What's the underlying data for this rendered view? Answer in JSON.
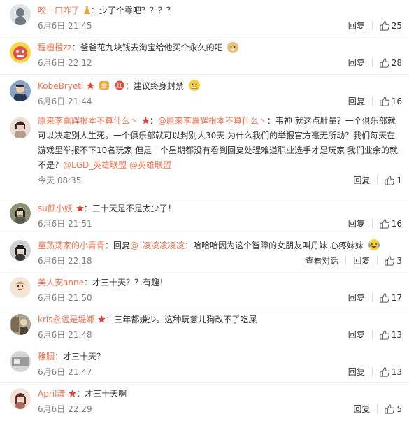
{
  "ui": {
    "reply_label": "回复",
    "view_thread_label": "查看对话"
  },
  "comments": [
    {
      "user": "咬一口咋了",
      "sep": "：",
      "text": "少了个零吧？？？？",
      "time": "6月6日 21:45",
      "likes": "25",
      "avatar_color": "#6d7a84"
    },
    {
      "user": "程檀橙zz",
      "sep": "：",
      "text": "爸爸花九块钱去淘宝给他买个永久的吧",
      "time": "6月6日 22:12",
      "likes": "28",
      "avatar_color": "#e8504a"
    },
    {
      "user": "KobeBryeti",
      "sep": "：",
      "text": "建议终身封禁",
      "time": "6月6日 21:44",
      "likes": "16",
      "avatar_color": "#2c3a55"
    },
    {
      "user": "原来李嘉辉根本不算什么丶",
      "sep": "：",
      "reply_to": "@原来李嘉辉根本不算什么丶",
      "text": "：韦神 就这点肚量？一个俱乐部就可以决定别人生死。一个俱乐部就可以封别人30天 为什么我们的举报官方毫无所动？我们每天在游戏里举报不下10名玩家 但是一个星期都没有看到回复处理难道职业选手才是玩家 我们业余的就不是？",
      "mentions": "@LGD_英雄联盟 @英雄联盟",
      "time": "今天 08:35",
      "likes": "1",
      "avatar_color": "#b89a8e"
    },
    {
      "user": "su颜小妖",
      "sep": "：",
      "text": "三十天是不是太少了！",
      "time": "6月6日 21:51",
      "likes": "16",
      "avatar_color": "#59604f"
    },
    {
      "user": "童荡荡家的小青青",
      "sep": "：",
      "reply_prefix": "回复",
      "reply_to": "@_凌凌凌凌凌",
      "text": "：哈哈哈因为这个智障的女朋友叫丹妹 心疼妹妹",
      "time": "6月6日 22:18",
      "likes": "3",
      "avatar_color": "#3a3a3a"
    },
    {
      "user": "美人安anne",
      "sep": "：",
      "text": "才三十天？？有趣！",
      "time": "6月6日 21:50",
      "likes": "17",
      "avatar_color": "#c8a07a"
    },
    {
      "user": "kris永远是堤娜",
      "sep": "：",
      "text": "三年都嫌少。这种玩意儿狗改不了吃屎",
      "time": "6月6日 21:48",
      "likes": "13",
      "avatar_color": "#7c6a52"
    },
    {
      "user": "稚胭",
      "sep": "：",
      "text": "才三十天？",
      "time": "6月6日 21:47",
      "likes": "13",
      "avatar_color": "#9a9a9a"
    },
    {
      "user": "April漾",
      "sep": "：",
      "text": "才三十天啊",
      "time": "6月6日 22:29",
      "likes": "5",
      "avatar_color": "#b0685a"
    }
  ]
}
